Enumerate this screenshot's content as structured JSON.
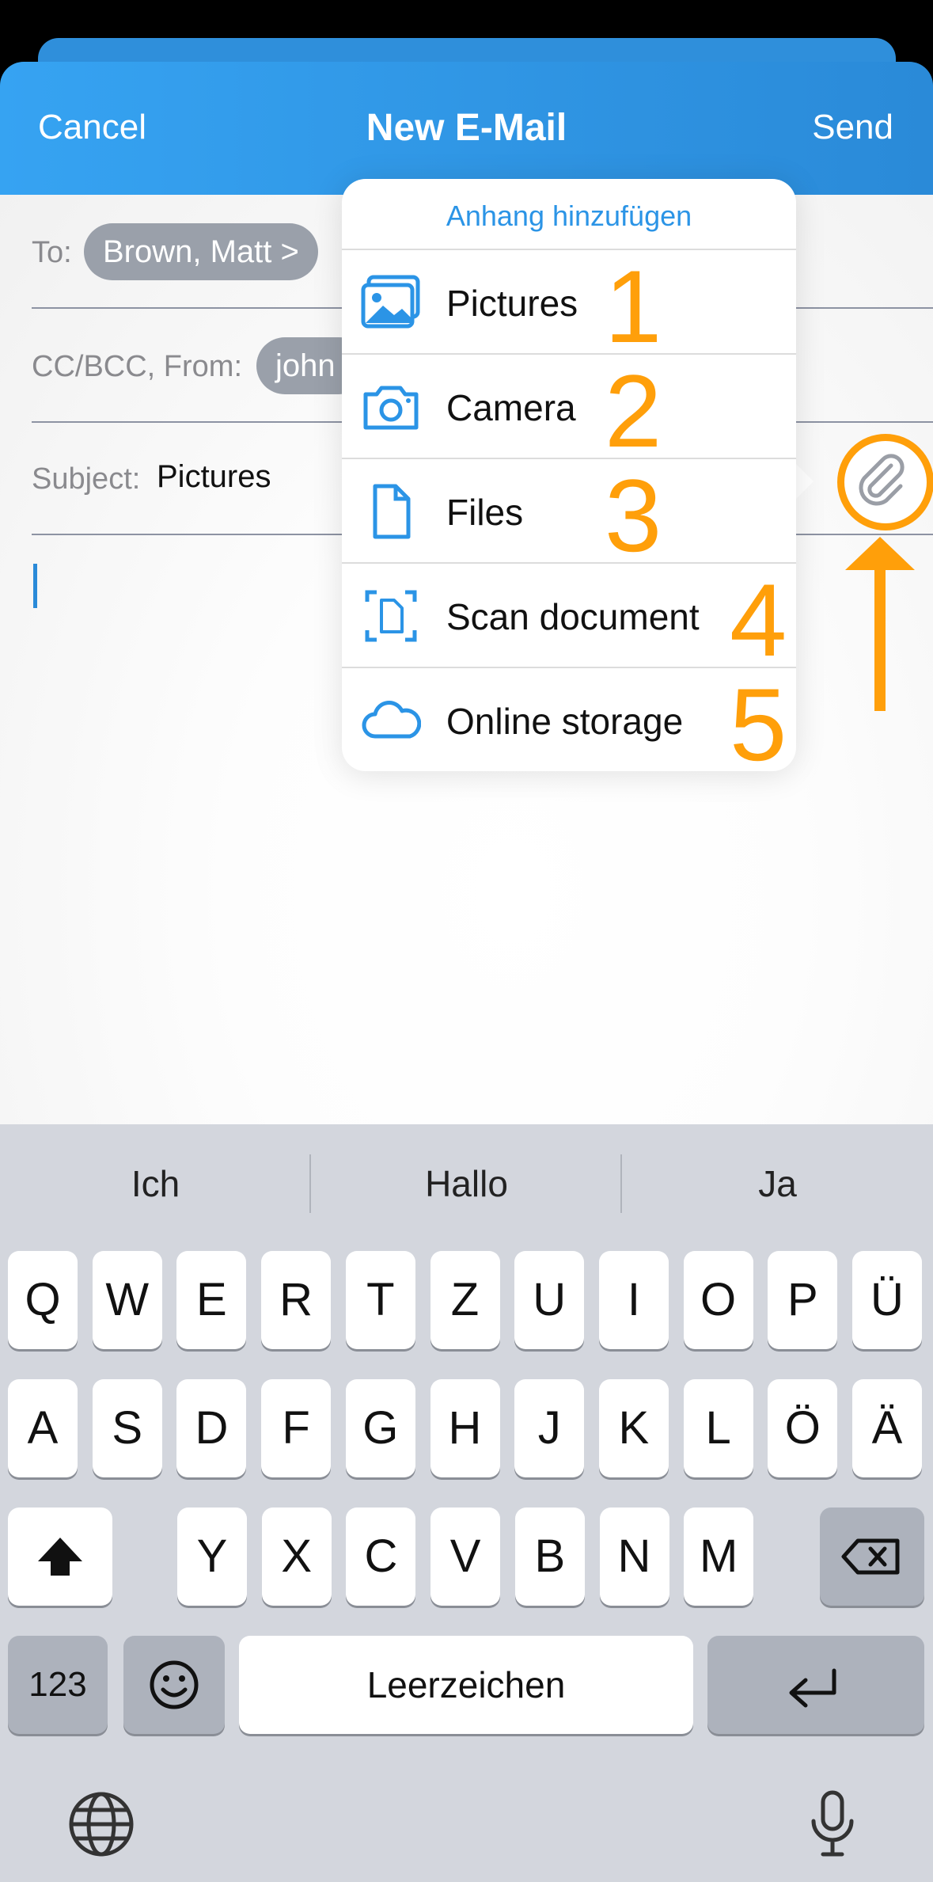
{
  "header": {
    "cancel": "Cancel",
    "title": "New E-Mail",
    "send": "Send"
  },
  "compose": {
    "to_label": "To:",
    "to_chip": "Brown, Matt  >",
    "cc_label": "CC/BCC, From:",
    "from_chip": "john",
    "subject_label": "Subject:",
    "subject_value": "Pictures"
  },
  "popover": {
    "title": "Anhang hinzufügen",
    "items": [
      {
        "label": "Pictures",
        "number": "1",
        "icon": "photo-icon"
      },
      {
        "label": "Camera",
        "number": "2",
        "icon": "camera-icon"
      },
      {
        "label": "Files",
        "number": "3",
        "icon": "file-icon"
      },
      {
        "label": "Scan document",
        "number": "4",
        "icon": "scan-document-icon"
      },
      {
        "label": "Online storage",
        "number": "5",
        "icon": "cloud-icon"
      }
    ]
  },
  "annotation": {
    "color": "#ff9f0a",
    "target_icon": "paperclip-icon"
  },
  "keyboard": {
    "suggestions": [
      "Ich",
      "Hallo",
      "Ja"
    ],
    "row1": [
      "Q",
      "W",
      "E",
      "R",
      "T",
      "Z",
      "U",
      "I",
      "O",
      "P",
      "Ü"
    ],
    "row2": [
      "A",
      "S",
      "D",
      "F",
      "G",
      "H",
      "J",
      "K",
      "L",
      "Ö",
      "Ä"
    ],
    "row3": [
      "Y",
      "X",
      "C",
      "V",
      "B",
      "N",
      "M"
    ],
    "numbers_key": "123",
    "space_key": "Leerzeichen"
  }
}
